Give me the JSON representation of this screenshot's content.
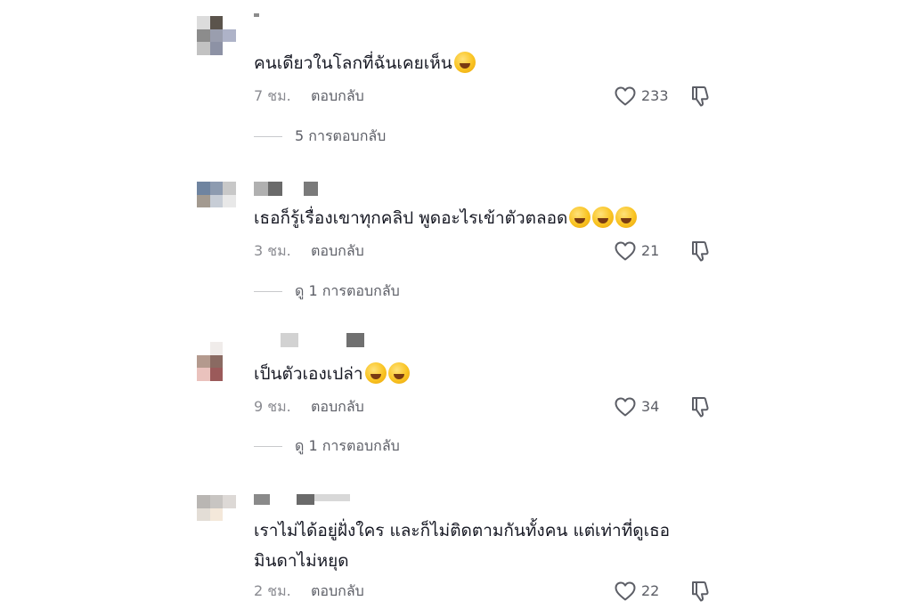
{
  "comments": [
    {
      "text": "คนเดียวในโลกที่ฉันเคยเห็น",
      "emoji": "grinning-sweat-emoji",
      "time": "7 ชม.",
      "reply_label": "ตอบกลับ",
      "likes": "233",
      "replies_label": "5 การตอบกลับ"
    },
    {
      "text": "เธอก็รู้เรื่องเขาทุกคลิป พูดอะไรเข้าตัวตลอด",
      "emoji": "rofl-emoji",
      "time": "3 ชม.",
      "reply_label": "ตอบกลับ",
      "likes": "21",
      "replies_label": "ดู 1 การตอบกลับ"
    },
    {
      "text": "เป็นตัวเองเปล่า",
      "emoji": "rofl-emoji",
      "time": "9 ชม.",
      "reply_label": "ตอบกลับ",
      "likes": "34",
      "replies_label": "ดู 1 การตอบกลับ"
    },
    {
      "text_line1": "เราไม่ได้อยู่ฝั่งใคร และก็ไม่ติดตามกันทั้งคน แต่เท่าที่ดูเธอ",
      "text_line2": "มินดาไม่หยุด",
      "time": "2 ชม.",
      "reply_label": "ตอบกลับ",
      "likes": "22"
    }
  ],
  "icons": {
    "like": "heart-outline-icon",
    "dislike": "thumbs-down-outline-icon"
  },
  "colors": {
    "text": "#161823",
    "muted": "#8a8b91",
    "secondary": "#5c5e66",
    "emoji": "#f9c321"
  }
}
